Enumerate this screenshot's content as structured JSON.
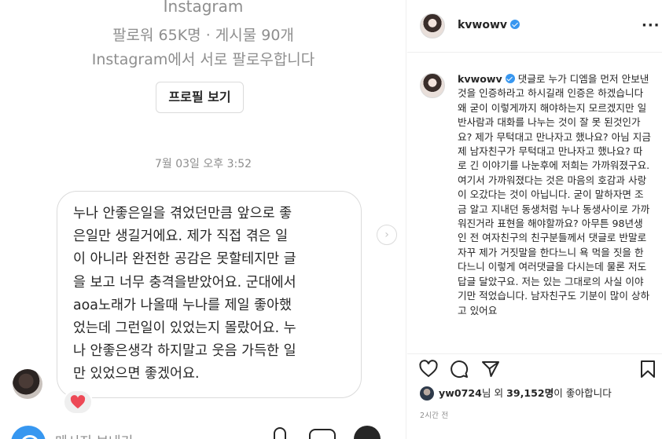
{
  "post_image": {
    "instagram_label": "Instagram",
    "profile_stats": "팔로워 65K명 · 게시물 90개",
    "mutual_follow": "Instagram에서 서로 팔로우합니다",
    "view_profile_label": "프로필 보기",
    "message_time": "7월 03일 오후 3:52",
    "message_text": "누나 안좋은일을 겪었던만큼 앞으로 좋\n은일만 생길거에요. 제가 직접 겪은 일\n이 아니라 완전한 공감은 못할테지만 글\n을 보고 너무 충격을받았어요. 군대에서\naoa노래가 나올때 누나를 제일 좋아했\n었는데 그런일이 있었는지 몰랐어요. 누\n나 안좋은생각 하지말고 웃음 가득한 일\n만 있었으면 좋겠어요.",
    "reaction_icon": "heart-icon",
    "composer_placeholder": "메시지 보내기..."
  },
  "header": {
    "username": "kvwowv",
    "verified_icon": "verified-badge-icon",
    "more_icon": "more-options-icon"
  },
  "caption": {
    "username": "kvwowv",
    "text": "댓글로 누가 디엠을 먼저 안보낸 것을 인증하라고 하시길래 인증은 하겠습니다 왜 굳이 이렇게까지 해야하는지 모르겠지만 일반사람과 대화를 나누는 것이 잘 못 된것인가요? 제가 무턱대고 만나자고 했나요? 아님 지금 제 남자친구가 무턱대고 만나자고 했나요? 따로 긴 이야기를 나눈후에 저희는 가까워졌구요. 여기서 가까워졌다는 것은 마음의 호감과 사랑이 오갔다는 것이 아닙니다. 굳이 말하자면 조금 알고 지내던 동생처럼 누나 동생사이로 가까워진거라 표현을 해야할까요? 아무튼 98년생인 전 여자친구의 친구분들께서 댓글로 반말로 자꾸 제가 거짓말을 한다느니 욕 먹을 짓을 한다느니 이렇게 여러댓글을 다시는데 물론 저도 답글 달았구요. 저는 있는 그대로의 사실 이야기만 적었습니다. 남자친구도 기분이 많이 상하고 있어요"
  },
  "likes": {
    "liker": "yw0724",
    "text_mid": "님 외 ",
    "count": "39,152명",
    "text_end": "이 좋아합니다"
  },
  "post_time": "2시간 전",
  "colors": {
    "verified": "#3897f0",
    "heart": "#ed4956",
    "border": "#dbdbdb",
    "secondary_text": "#8e8e8e"
  }
}
